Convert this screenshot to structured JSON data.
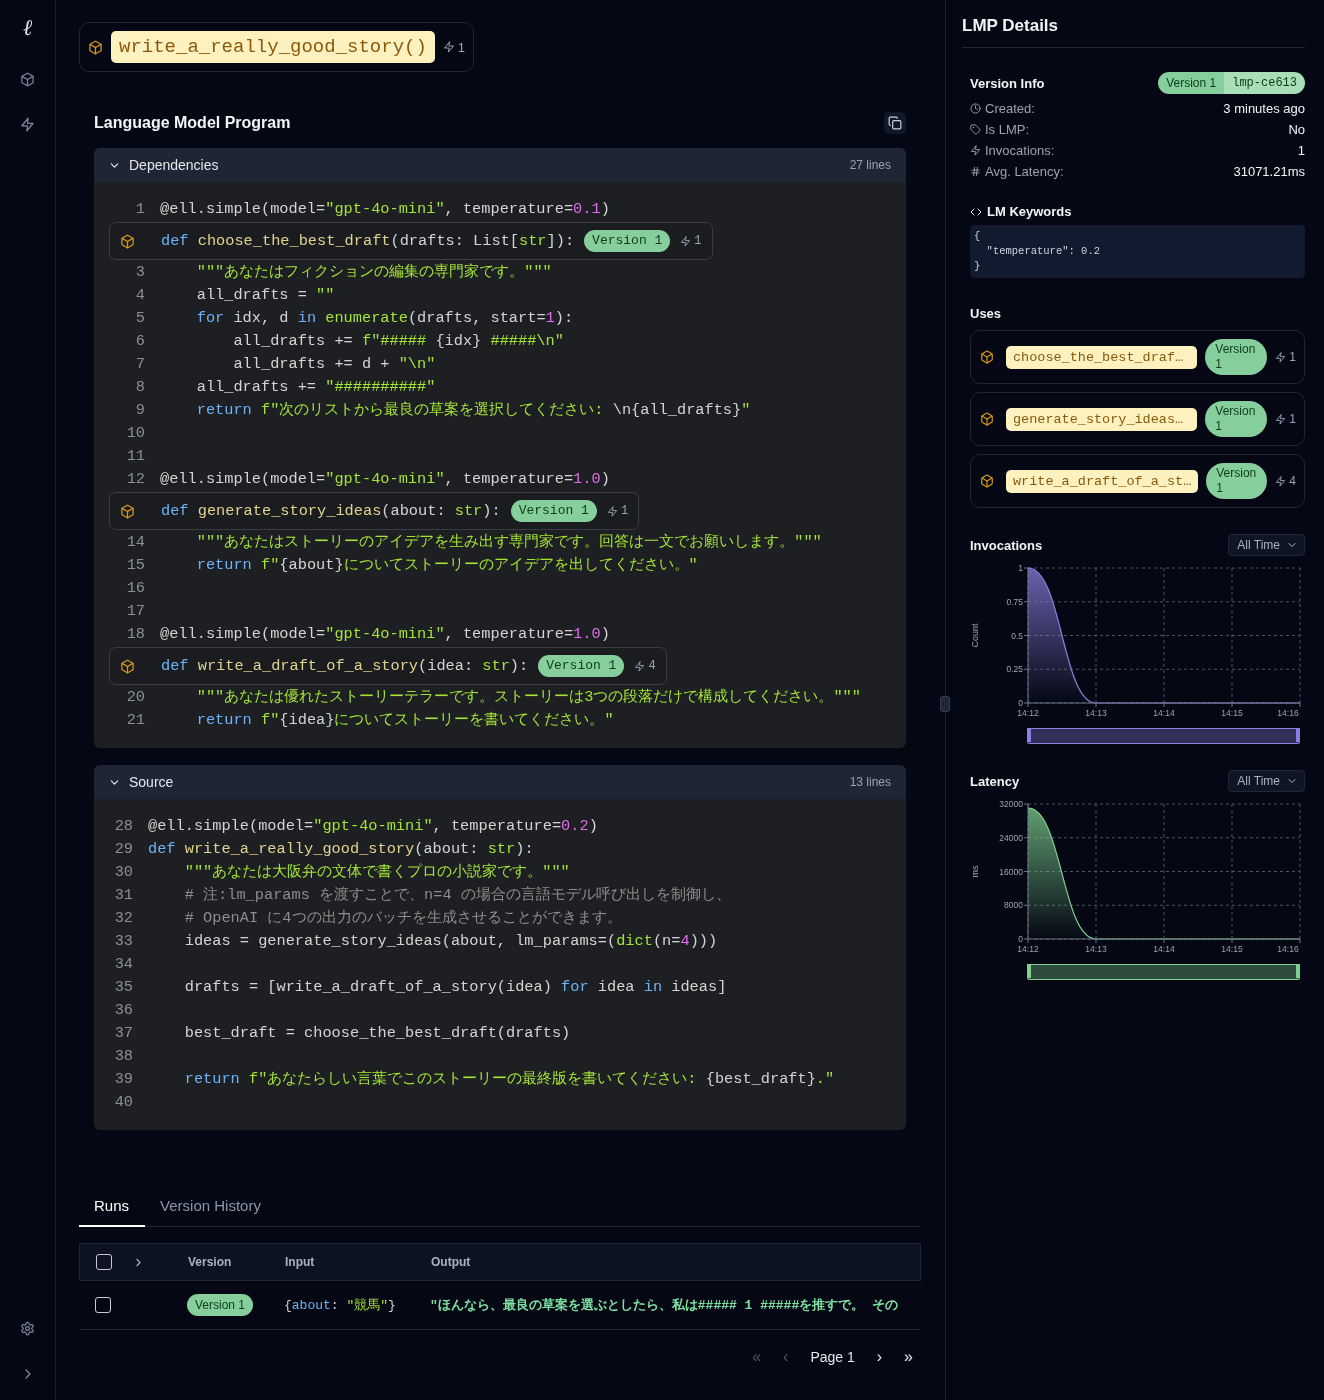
{
  "sidebar": {
    "logo": "ℓ"
  },
  "header": {
    "name": "write_a_really_good_story()",
    "invocations": "1"
  },
  "program": {
    "title": "Language Model Program",
    "panels": [
      {
        "title": "Dependencies",
        "expanded": true,
        "line_count": "27 lines",
        "lines": [
          {
            "kind": "code",
            "number": "1",
            "tokens": [
              {
                "kind": "plain",
                "text": "@ell.simple(model="
              },
              {
                "kind": "string",
                "text": "\"gpt-4o-mini\""
              },
              {
                "kind": "plain",
                "text": ", temperature="
              },
              {
                "kind": "number",
                "text": "0.1"
              },
              {
                "kind": "plain",
                "text": ")"
              }
            ]
          },
          {
            "kind": "lmp",
            "version": "Version 1",
            "invocations": "1",
            "tokens": [
              {
                "kind": "keyword",
                "text": "def "
              },
              {
                "kind": "function",
                "text": "choose_the_best_draft"
              },
              {
                "kind": "plain",
                "text": "(drafts: List["
              },
              {
                "kind": "string",
                "text": "str"
              },
              {
                "kind": "plain",
                "text": "]):"
              }
            ]
          },
          {
            "kind": "code",
            "number": "3",
            "tokens": [
              {
                "kind": "string",
                "text": "    \"\"\"あなたはフィクションの編集の専門家です。\"\"\""
              }
            ]
          },
          {
            "kind": "code",
            "number": "4",
            "tokens": [
              {
                "kind": "plain",
                "text": "    all_drafts = "
              },
              {
                "kind": "string",
                "text": "\"\""
              }
            ]
          },
          {
            "kind": "code",
            "number": "5",
            "tokens": [
              {
                "kind": "keyword",
                "text": "    for"
              },
              {
                "kind": "plain",
                "text": " idx, d "
              },
              {
                "kind": "keyword",
                "text": "in "
              },
              {
                "kind": "string",
                "text": "enumerate"
              },
              {
                "kind": "plain",
                "text": "(drafts, start="
              },
              {
                "kind": "number",
                "text": "1"
              },
              {
                "kind": "plain",
                "text": "):"
              }
            ]
          },
          {
            "kind": "code",
            "number": "6",
            "tokens": [
              {
                "kind": "plain",
                "text": "        all_drafts += "
              },
              {
                "kind": "string",
                "text": "f\"##### "
              },
              {
                "kind": "plain",
                "text": "{idx}"
              },
              {
                "kind": "string",
                "text": " #####\\n\""
              }
            ]
          },
          {
            "kind": "code",
            "number": "7",
            "tokens": [
              {
                "kind": "plain",
                "text": "        all_drafts += d + "
              },
              {
                "kind": "string",
                "text": "\"\\n\""
              }
            ]
          },
          {
            "kind": "code",
            "number": "8",
            "tokens": [
              {
                "kind": "plain",
                "text": "    all_drafts += "
              },
              {
                "kind": "string",
                "text": "\"##########\""
              }
            ]
          },
          {
            "kind": "code",
            "number": "9",
            "tokens": [
              {
                "kind": "keyword",
                "text": "    return "
              },
              {
                "kind": "string",
                "text": "f\"次のリストから最良の草案を選択してください: "
              },
              {
                "kind": "plain",
                "text": "\\n{all_drafts}"
              },
              {
                "kind": "string",
                "text": "\""
              }
            ]
          },
          {
            "kind": "code",
            "number": "10"
          },
          {
            "kind": "code",
            "number": "11"
          },
          {
            "kind": "code",
            "number": "12",
            "tokens": [
              {
                "kind": "plain",
                "text": "@ell.simple(model="
              },
              {
                "kind": "string",
                "text": "\"gpt-4o-mini\""
              },
              {
                "kind": "plain",
                "text": ", temperature="
              },
              {
                "kind": "number",
                "text": "1.0"
              },
              {
                "kind": "plain",
                "text": ")"
              }
            ]
          },
          {
            "kind": "lmp",
            "version": "Version 1",
            "invocations": "1",
            "tokens": [
              {
                "kind": "keyword",
                "text": "def "
              },
              {
                "kind": "function",
                "text": "generate_story_ideas"
              },
              {
                "kind": "plain",
                "text": "(about: "
              },
              {
                "kind": "string",
                "text": "str"
              },
              {
                "kind": "plain",
                "text": "):"
              }
            ]
          },
          {
            "kind": "code",
            "number": "14",
            "tokens": [
              {
                "kind": "string",
                "text": "    \"\"\"あなたはストーリーのアイデアを生み出す専門家です。回答は一文でお願いします。\"\"\""
              }
            ]
          },
          {
            "kind": "code",
            "number": "15",
            "tokens": [
              {
                "kind": "keyword",
                "text": "    return "
              },
              {
                "kind": "string",
                "text": "f\""
              },
              {
                "kind": "plain",
                "text": "{about}"
              },
              {
                "kind": "string",
                "text": "についてストーリーのアイデアを出してください。\""
              }
            ]
          },
          {
            "kind": "code",
            "number": "16"
          },
          {
            "kind": "code",
            "number": "17"
          },
          {
            "kind": "code",
            "number": "18",
            "tokens": [
              {
                "kind": "plain",
                "text": "@ell.simple(model="
              },
              {
                "kind": "string",
                "text": "\"gpt-4o-mini\""
              },
              {
                "kind": "plain",
                "text": ", temperature="
              },
              {
                "kind": "number",
                "text": "1.0"
              },
              {
                "kind": "plain",
                "text": ")"
              }
            ]
          },
          {
            "kind": "lmp",
            "version": "Version 1",
            "invocations": "4",
            "tokens": [
              {
                "kind": "keyword",
                "text": "def "
              },
              {
                "kind": "function",
                "text": "write_a_draft_of_a_story"
              },
              {
                "kind": "plain",
                "text": "(idea: "
              },
              {
                "kind": "string",
                "text": "str"
              },
              {
                "kind": "plain",
                "text": "):"
              }
            ]
          },
          {
            "kind": "code",
            "number": "20",
            "tokens": [
              {
                "kind": "string",
                "text": "    \"\"\"あなたは優れたストーリーテラーです。ストーリーは3つの段落だけで構成してください。\"\"\""
              }
            ]
          },
          {
            "kind": "code",
            "number": "21",
            "tokens": [
              {
                "kind": "keyword",
                "text": "    return "
              },
              {
                "kind": "string",
                "text": "f\""
              },
              {
                "kind": "plain",
                "text": "{idea}"
              },
              {
                "kind": "string",
                "text": "についてストーリーを書いてください。\""
              }
            ]
          }
        ]
      },
      {
        "title": "Source",
        "expanded": true,
        "line_count": "13 lines",
        "lines": [
          {
            "kind": "code",
            "number": "28",
            "tokens": [
              {
                "kind": "plain",
                "text": "@ell.simple(model="
              },
              {
                "kind": "string",
                "text": "\"gpt-4o-mini\""
              },
              {
                "kind": "plain",
                "text": ", temperature="
              },
              {
                "kind": "number",
                "text": "0.2"
              },
              {
                "kind": "plain",
                "text": ")"
              }
            ]
          },
          {
            "kind": "code",
            "number": "29",
            "tokens": [
              {
                "kind": "keyword",
                "text": "def "
              },
              {
                "kind": "function",
                "text": "write_a_really_good_story"
              },
              {
                "kind": "plain",
                "text": "(about: "
              },
              {
                "kind": "string",
                "text": "str"
              },
              {
                "kind": "plain",
                "text": "):"
              }
            ]
          },
          {
            "kind": "code",
            "number": "30",
            "tokens": [
              {
                "kind": "string",
                "text": "    \"\"\"あなたは大阪弁の文体で書くプロの小説家です。\"\"\""
              }
            ]
          },
          {
            "kind": "code",
            "number": "31",
            "tokens": [
              {
                "kind": "comment",
                "text": "    # 注:lm_params を渡すことで、n=4 の場合の言語モデル呼び出しを制御し、"
              }
            ]
          },
          {
            "kind": "code",
            "number": "32",
            "tokens": [
              {
                "kind": "comment",
                "text": "    # OpenAI に4つの出力のバッチを生成させることができます。"
              }
            ]
          },
          {
            "kind": "code",
            "number": "33",
            "tokens": [
              {
                "kind": "plain",
                "text": "    ideas = generate_story_ideas(about, lm_params=("
              },
              {
                "kind": "string",
                "text": "dict"
              },
              {
                "kind": "plain",
                "text": "(n="
              },
              {
                "kind": "number",
                "text": "4"
              },
              {
                "kind": "plain",
                "text": ")))"
              }
            ]
          },
          {
            "kind": "code",
            "number": "34"
          },
          {
            "kind": "code",
            "number": "35",
            "tokens": [
              {
                "kind": "plain",
                "text": "    drafts = [write_a_draft_of_a_story(idea) "
              },
              {
                "kind": "keyword",
                "text": "for"
              },
              {
                "kind": "plain",
                "text": " idea "
              },
              {
                "kind": "keyword",
                "text": "in"
              },
              {
                "kind": "plain",
                "text": " ideas]"
              }
            ]
          },
          {
            "kind": "code",
            "number": "36"
          },
          {
            "kind": "code",
            "number": "37",
            "tokens": [
              {
                "kind": "plain",
                "text": "    best_draft = choose_the_best_draft(drafts)"
              }
            ]
          },
          {
            "kind": "code",
            "number": "38"
          },
          {
            "kind": "code",
            "number": "39",
            "tokens": [
              {
                "kind": "keyword",
                "text": "    return "
              },
              {
                "kind": "string",
                "text": "f\"あなたらしい言葉でこのストーリーの最終版を書いてください: "
              },
              {
                "kind": "plain",
                "text": "{best_draft}"
              },
              {
                "kind": "string",
                "text": ".\""
              }
            ]
          },
          {
            "kind": "code",
            "number": "40"
          }
        ]
      }
    ]
  },
  "runs": {
    "tabs": [
      {
        "label": "Runs",
        "selected": true
      },
      {
        "label": "Version History",
        "selected": false
      }
    ],
    "table": {
      "header_checked": false,
      "columns": [
        "Version",
        "Input",
        "Output"
      ],
      "rows": [
        {
          "checked": false,
          "version": "Version 1",
          "input": [
            {
              "kind": "plain",
              "text": "{"
            },
            {
              "kind": "keyword",
              "text": "about"
            },
            {
              "kind": "plain",
              "text": ": "
            },
            {
              "kind": "string",
              "text": "\"競馬\""
            },
            {
              "kind": "plain",
              "text": "}"
            }
          ],
          "output": "\"ほんなら、最良の草案を選ぶとしたら、私は##### 1 #####を推すで。 その"
        }
      ]
    },
    "pagination": {
      "buttons": [
        {
          "label": "«",
          "disabled": true
        },
        {
          "label": "‹",
          "disabled": true
        },
        {
          "label": "›",
          "disabled": false
        },
        {
          "label": "»",
          "disabled": false
        }
      ],
      "page": "Page 1"
    }
  },
  "details": {
    "title": "LMP Details",
    "version_info": {
      "title": "Version Info",
      "version": "Version 1",
      "id": "lmp-ce613",
      "rows": [
        {
          "label": "Created:",
          "value": "3 minutes ago"
        },
        {
          "label": "Is LMP:",
          "value": "No"
        },
        {
          "label": "Invocations:",
          "value": "1"
        },
        {
          "label": "Avg. Latency:",
          "value": "31071.21ms"
        }
      ]
    },
    "lm_keywords": {
      "title": "LM Keywords",
      "code": "{\n  \"temperature\": 0.2\n}"
    },
    "uses": {
      "title": "Uses",
      "items": [
        {
          "name": "choose_the_best_draf…",
          "version": "Version 1",
          "invocations": "1"
        },
        {
          "name": "generate_story_ideas…",
          "version": "Version 1",
          "invocations": "1"
        },
        {
          "name": "write_a_draft_of_a_st…",
          "version": "Version 1",
          "invocations": "4"
        }
      ]
    },
    "charts": [
      {
        "range": "All Time",
        "chart_data": {
          "type": "area",
          "title": "Invocations",
          "ylabel": "Count",
          "grid": true,
          "x": [
            "14:12",
            "14:13",
            "14:14",
            "14:15",
            "14:16"
          ],
          "series": [
            {
              "color": "#8b7fe0",
              "values": [
                1,
                0,
                0,
                0,
                0
              ]
            }
          ],
          "ylim": [
            0,
            1
          ],
          "yticks": [
            0,
            0.25,
            0.5,
            0.75,
            1
          ]
        }
      },
      {
        "range": "All Time",
        "chart_data": {
          "type": "area",
          "title": "Latency",
          "ylabel": "ms",
          "grid": true,
          "x": [
            "14:12",
            "14:13",
            "14:14",
            "14:15",
            "14:16"
          ],
          "series": [
            {
              "color": "#7fd08f",
              "values": [
                31000,
                0,
                0,
                0,
                0
              ]
            }
          ],
          "ylim": [
            0,
            32000
          ],
          "yticks": [
            0,
            8000,
            16000,
            24000,
            32000
          ]
        }
      }
    ]
  }
}
